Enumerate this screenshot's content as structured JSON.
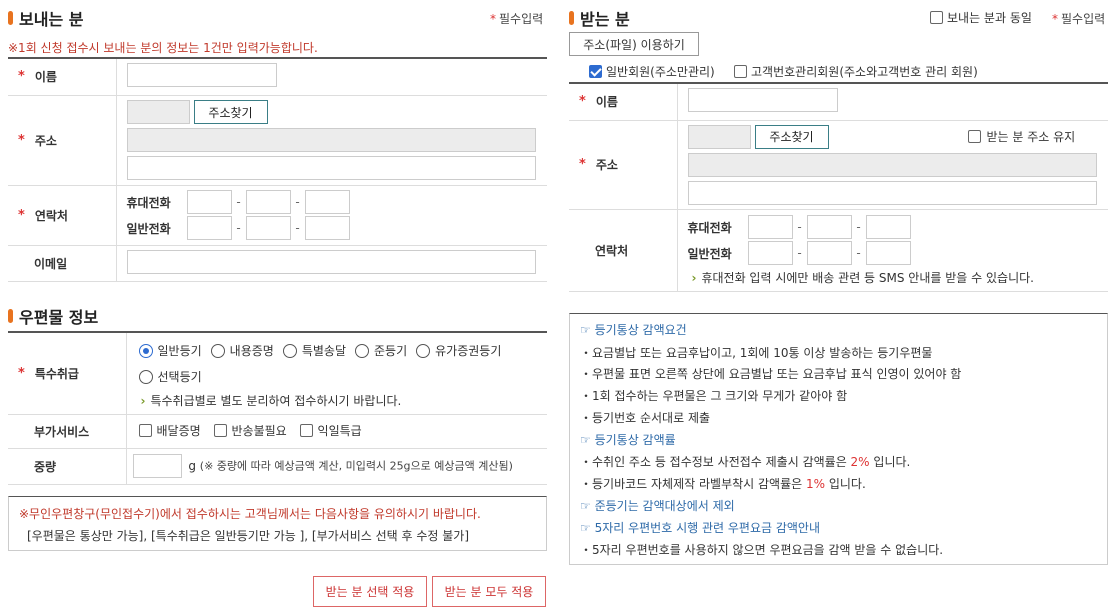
{
  "sender": {
    "title": "보내는 분",
    "required": "필수입력",
    "notice": "※1회 신청 접수시 보내는 분의 정보는 1건만 입력가능합니다.",
    "name_label": "이름",
    "address_label": "주소",
    "address_button": "주소찾기",
    "contact_label": "연락처",
    "mobile_label": "휴대전화",
    "phone_label": "일반전화",
    "email_label": "이메일"
  },
  "receiver": {
    "title": "받는 분",
    "same_as_sender": "보내는 분과 동일",
    "required": "필수입력",
    "file_button": "주소(파일) 이용하기",
    "member_general": "일반회원(주소만관리)",
    "member_customer": "고객번호관리회원(주소와고객번호 관리 회원)",
    "name_label": "이름",
    "address_label": "주소",
    "address_button": "주소찾기",
    "keep_address": "받는 분 주소 유지",
    "contact_label": "연락처",
    "mobile_label": "휴대전화",
    "phone_label": "일반전화",
    "sms_note": "휴대전화 입력 시에만 배송 관련 등 SMS 안내를 받을 수 있습니다."
  },
  "postal": {
    "title": "우편물 정보",
    "special_label": "특수취급",
    "special_options": [
      "일반등기",
      "내용증명",
      "특별송달",
      "준등기",
      "유가증권등기",
      "선택등기"
    ],
    "special_note": "특수취급별로 별도 분리하여 접수하시기 바랍니다.",
    "extra_label": "부가서비스",
    "extra_options": [
      "배달증명",
      "반송불필요",
      "익일특급"
    ],
    "weight_label": "중량",
    "weight_unit": "g",
    "weight_note": "(※ 중량에 따라 예상금액 계산, 미입력시 25g으로 예상금액 계산됨)"
  },
  "caution": {
    "line1": "※무인우편창구(무인접수기)에서 접수하시는 고객님께서는 다음사항을 유의하시기 바랍니다.",
    "line2": "[우편물은 통상만 가능], [특수취급은 일반등기만 가능 ], [부가서비스 선택 후 수정 불가]"
  },
  "info": {
    "h1": "☞ 등기통상 감액요건",
    "b1": "・요금별납 또는 요금후납이고, 1회에 10통 이상 발송하는 등기우편물",
    "b2": "・우편물 표면 오른쪽 상단에 요금별납 또는 요금후납 표식 인영이 있어야 함",
    "b3": "・1회 접수하는 우편물은 그 크기와 무게가 같아야 함",
    "b4": "・등기번호 순서대로 제출",
    "h2": "☞ 등기통상 감액률",
    "b5_pre": "・수취인 주소 등 접수정보 사전접수 제출시 감액률은 ",
    "b5_hl": "2%",
    "b5_post": " 입니다.",
    "b6_pre": "・등기바코드 자체제작 라벨부착시 감액률은 ",
    "b6_hl": "1%",
    "b6_post": " 입니다.",
    "h3": "☞ 준등기는 감액대상에서 제외",
    "h4": "☞ 5자리 우편번호 시행 관련 우편요금 감액안내",
    "b7": "・5자리 우편번호를 사용하지 않으면 우편요금을 감액 받을 수 없습니다."
  },
  "buttons": {
    "apply_selected": "받는 분 선택 적용",
    "apply_all": "받는 분 모두 적용"
  }
}
